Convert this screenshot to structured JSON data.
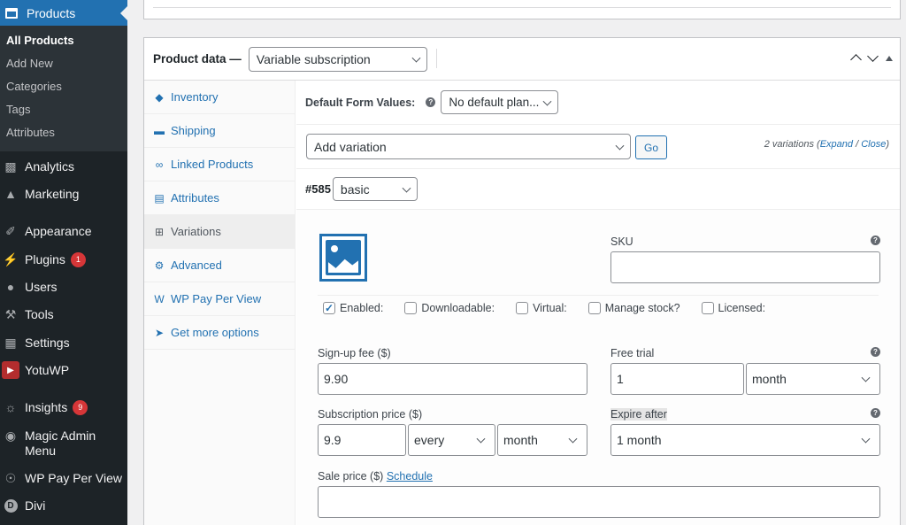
{
  "sidebar": {
    "active_menu": "Products",
    "submenu": [
      "All Products",
      "Add New",
      "Categories",
      "Tags",
      "Attributes"
    ],
    "items": [
      {
        "label": "Analytics",
        "icon": "bar-chart-icon"
      },
      {
        "label": "Marketing",
        "icon": "megaphone-icon"
      },
      {
        "label": "Appearance",
        "icon": "paintbrush-icon"
      },
      {
        "label": "Plugins",
        "icon": "plug-icon",
        "badge": "1"
      },
      {
        "label": "Users",
        "icon": "user-icon"
      },
      {
        "label": "Tools",
        "icon": "wrench-icon"
      },
      {
        "label": "Settings",
        "icon": "settings-icon"
      },
      {
        "label": "YotuWP",
        "icon": "youtube-icon"
      },
      {
        "label": "Insights",
        "icon": "insights-icon",
        "badge": "9"
      },
      {
        "label": "Magic Admin Menu",
        "icon": "magic-icon"
      },
      {
        "label": "WP Pay Per View",
        "icon": "eye-icon"
      },
      {
        "label": "Divi",
        "icon": "divi-icon"
      }
    ]
  },
  "product_data": {
    "title": "Product data —",
    "type_select": "Variable subscription",
    "tabs": [
      {
        "label": "Inventory",
        "icon": "tag-icon"
      },
      {
        "label": "Shipping",
        "icon": "truck-icon"
      },
      {
        "label": "Linked Products",
        "icon": "link-icon"
      },
      {
        "label": "Attributes",
        "icon": "table-icon"
      },
      {
        "label": "Variations",
        "icon": "grid-icon"
      },
      {
        "label": "Advanced",
        "icon": "gear-icon"
      },
      {
        "label": "WP Pay Per View",
        "icon": "w-icon",
        "glyph": "W"
      },
      {
        "label": "Get more options",
        "icon": "plugin-icon"
      }
    ]
  },
  "variations": {
    "default_form_label": "Default Form Values:",
    "default_form_value": "No default plan...",
    "add_variation": "Add variation",
    "go_label": "Go",
    "count_text": "2 variations",
    "expand": "Expand",
    "close": "Close",
    "variation_id": "#585",
    "variation_value": "basic"
  },
  "variation_form": {
    "sku_label": "SKU",
    "sku_value": "",
    "checkboxes": [
      {
        "label": "Enabled:",
        "checked": true
      },
      {
        "label": "Downloadable:",
        "checked": false
      },
      {
        "label": "Virtual:",
        "checked": false
      },
      {
        "label": "Manage stock?",
        "checked": false
      },
      {
        "label": "Licensed:",
        "checked": false
      }
    ],
    "signup_fee_label": "Sign-up fee ($)",
    "signup_fee_value": "9.90",
    "free_trial_label": "Free trial",
    "free_trial_value": "1",
    "free_trial_period": "month",
    "subscription_price_label": "Subscription price ($)",
    "subscription_price_value": "9.9",
    "billing_interval": "every",
    "billing_period": "month",
    "expire_label": "Expire after",
    "expire_value": "1 month",
    "sale_price_label": "Sale price ($)",
    "schedule_label": "Schedule",
    "sale_price_value": ""
  },
  "colors": {
    "accent": "#2271b1",
    "sidebar": "#1d2327",
    "badge": "#d63638"
  }
}
